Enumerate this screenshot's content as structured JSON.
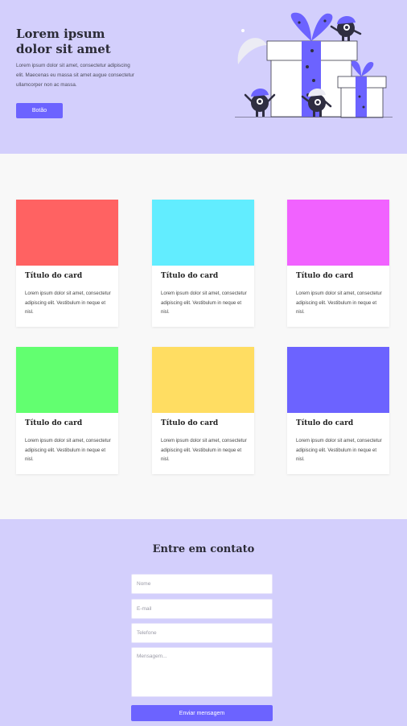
{
  "hero": {
    "title": "Lorem ipsum dolor sit amet",
    "text": "Lorem ipsum dolor sit amet, consectetur adipiscing elit. Maecenas eu massa sit amet augue consectetur ullamcorper non ac massa.",
    "button_label": "Botão"
  },
  "cards": [
    {
      "title": "Título do card",
      "text": "Lorem ipsum dolor sit amet, consectetur adipiscing elit. Vestibulum in neque et nisl.",
      "color": "#ff6262"
    },
    {
      "title": "Título do card",
      "text": "Lorem ipsum dolor sit amet, consectetur adipiscing elit. Vestibulum in neque et nisl.",
      "color": "#62edff"
    },
    {
      "title": "Título do card",
      "text": "Lorem ipsum dolor sit amet, consectetur adipiscing elit. Vestibulum in neque et nisl.",
      "color": "#f162ff"
    },
    {
      "title": "Título do card",
      "text": "Lorem ipsum dolor sit amet, consectetur adipiscing elit. Vestibulum in neque et nisl.",
      "color": "#62ff70"
    },
    {
      "title": "Título do card",
      "text": "Lorem ipsum dolor sit amet, consectetur adipiscing elit. Vestibulum in neque et nisl.",
      "color": "#ffdd62"
    },
    {
      "title": "Título do card",
      "text": "Lorem ipsum dolor sit amet, consectetur adipiscing elit. Vestibulum in neque et nisl.",
      "color": "#6c63ff"
    }
  ],
  "contact": {
    "title": "Entre em contato",
    "name_placeholder": "Nome",
    "email_placeholder": "E-mail",
    "phone_placeholder": "Telefone",
    "message_placeholder": "Mensagem...",
    "submit_label": "Enviar mensagem"
  },
  "colors": {
    "accent": "#6c63ff",
    "hero_bg": "#d3cffc",
    "section_bg": "#f8f8f8"
  },
  "icons": {
    "hero_illustration": "gift-boxes-monsters-illustration"
  }
}
